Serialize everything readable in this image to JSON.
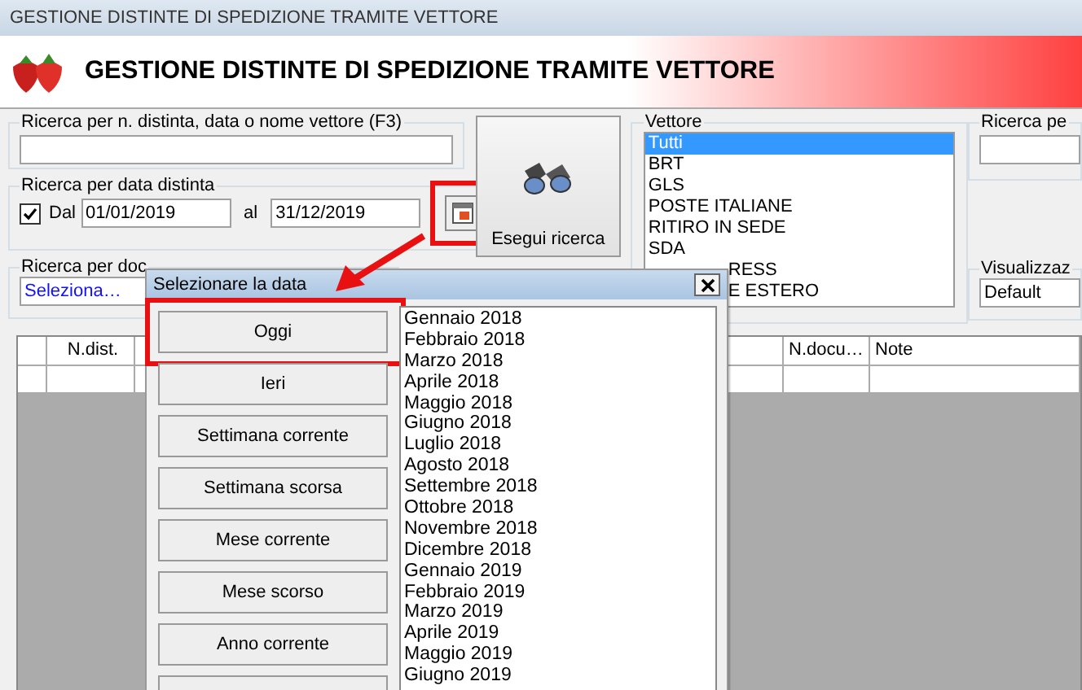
{
  "window": {
    "title": "GESTIONE DISTINTE DI SPEDIZIONE TRAMITE VETTORE"
  },
  "header": {
    "title": "GESTIONE DISTINTE DI SPEDIZIONE TRAMITE VETTORE"
  },
  "search_text": {
    "label": "Ricerca per n. distinta, data o nome vettore (F3)"
  },
  "date_search": {
    "label": "Ricerca per data distinta",
    "checked": true,
    "from_label": "Dal",
    "from": "01/01/2019",
    "to_label": "al",
    "to": "31/12/2019",
    "calendar_highlighted": true
  },
  "search_button": {
    "label": "Esegui ricerca"
  },
  "carrier": {
    "label": "Vettore",
    "items": [
      {
        "text": "Tutti",
        "selected": true,
        "covered": false
      },
      {
        "text": "BRT",
        "selected": false,
        "covered": false
      },
      {
        "text": "GLS",
        "selected": false,
        "covered": false
      },
      {
        "text": "POSTE ITALIANE",
        "selected": false,
        "covered": false
      },
      {
        "text": "RITIRO IN SEDE",
        "selected": false,
        "covered": false
      },
      {
        "text": "SDA",
        "selected": false,
        "covered": false
      },
      {
        "text": "RESS",
        "selected": false,
        "covered": true
      },
      {
        "text": "E ESTERO",
        "selected": false,
        "covered": true
      }
    ]
  },
  "search_other": {
    "label": "Ricerca pe"
  },
  "document_search": {
    "label": "Ricerca per doc",
    "value": "Seleziona…"
  },
  "view": {
    "label": "Visualizzaz",
    "value": "Default"
  },
  "table": {
    "columns": [
      {
        "label": "N.dist."
      },
      {
        "label": "N.docu…"
      },
      {
        "label": "Note"
      }
    ]
  },
  "dialog": {
    "title": "Selezionare la data",
    "buttons": [
      {
        "label": "Oggi",
        "highlighted": true
      },
      {
        "label": "Ieri",
        "highlighted": false
      },
      {
        "label": "Settimana corrente",
        "highlighted": false
      },
      {
        "label": "Settimana scorsa",
        "highlighted": false
      },
      {
        "label": "Mese corrente",
        "highlighted": false
      },
      {
        "label": "Mese scorso",
        "highlighted": false
      },
      {
        "label": "Anno corrente",
        "highlighted": false
      }
    ],
    "months": [
      "Gennaio 2018",
      "Febbraio 2018",
      "Marzo 2018",
      "Aprile 2018",
      "Maggio 2018",
      "Giugno 2018",
      "Luglio 2018",
      "Agosto 2018",
      "Settembre 2018",
      "Ottobre 2018",
      "Novembre 2018",
      "Dicembre 2018",
      "Gennaio 2019",
      "Febbraio 2019",
      "Marzo 2019",
      "Aprile 2019",
      "Maggio 2019",
      "Giugno 2019"
    ]
  }
}
